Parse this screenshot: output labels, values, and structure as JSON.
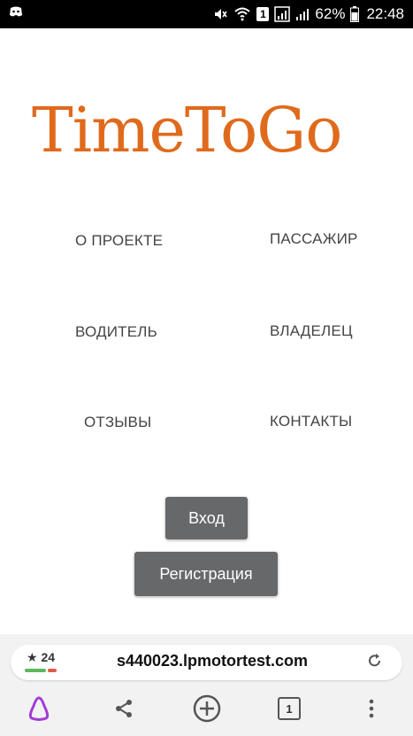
{
  "status_bar": {
    "battery_percent": "62%",
    "time": "22:48",
    "sim_label": "1"
  },
  "logo": {
    "text": "TimeToGo",
    "color": "#e06a1c"
  },
  "nav": {
    "about": "О ПРОЕКТЕ",
    "passenger": "ПАССАЖИР",
    "driver": "ВОДИТЕЛЬ",
    "owner": "ВЛАДЕЛЕЦ",
    "reviews": "ОТЗЫВЫ",
    "contacts": "КОНТАКТЫ"
  },
  "auth": {
    "login_label": "Вход",
    "register_label": "Регистрация",
    "button_color": "#66686a"
  },
  "browser": {
    "rating": "★ 24",
    "url": "s440023.lpmotortest.com",
    "tab_count": "1",
    "accent": "#a23bd6"
  }
}
